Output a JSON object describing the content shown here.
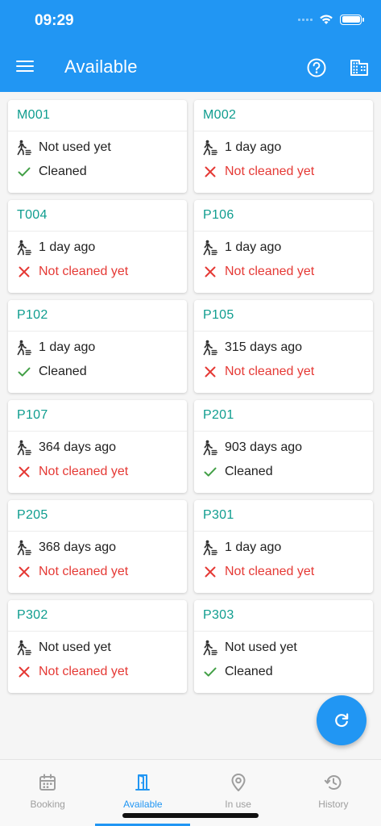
{
  "status_bar": {
    "time": "09:29"
  },
  "app_bar": {
    "title": "Available"
  },
  "colors": {
    "primary": "#2196f3",
    "room_code": "#0f9d8f",
    "ok": "#43a047",
    "bad": "#e53935"
  },
  "rooms": [
    {
      "code": "M001",
      "last_used": "Not used yet",
      "clean_status": "Cleaned",
      "cleaned": true
    },
    {
      "code": "M002",
      "last_used": "1 day ago",
      "clean_status": "Not cleaned yet",
      "cleaned": false
    },
    {
      "code": "T004",
      "last_used": "1 day ago",
      "clean_status": "Not cleaned yet",
      "cleaned": false
    },
    {
      "code": "P106",
      "last_used": "1 day ago",
      "clean_status": "Not cleaned yet",
      "cleaned": false
    },
    {
      "code": "P102",
      "last_used": "1 day ago",
      "clean_status": "Cleaned",
      "cleaned": true
    },
    {
      "code": "P105",
      "last_used": "315 days ago",
      "clean_status": "Not cleaned yet",
      "cleaned": false
    },
    {
      "code": "P107",
      "last_used": "364 days ago",
      "clean_status": "Not cleaned yet",
      "cleaned": false
    },
    {
      "code": "P201",
      "last_used": "903 days ago",
      "clean_status": "Cleaned",
      "cleaned": true
    },
    {
      "code": "P205",
      "last_used": "368 days ago",
      "clean_status": "Not cleaned yet",
      "cleaned": false
    },
    {
      "code": "P301",
      "last_used": "1 day ago",
      "clean_status": "Not cleaned yet",
      "cleaned": false
    },
    {
      "code": "P302",
      "last_used": "Not used yet",
      "clean_status": "Not cleaned yet",
      "cleaned": false
    },
    {
      "code": "P303",
      "last_used": "Not used yet",
      "clean_status": "Cleaned",
      "cleaned": true
    }
  ],
  "bottom_nav": {
    "items": [
      {
        "label": "Booking",
        "icon": "calendar-icon",
        "active": false
      },
      {
        "label": "Available",
        "icon": "door-icon",
        "active": true
      },
      {
        "label": "In use",
        "icon": "location-pin-icon",
        "active": false
      },
      {
        "label": "History",
        "icon": "history-icon",
        "active": false
      }
    ]
  }
}
